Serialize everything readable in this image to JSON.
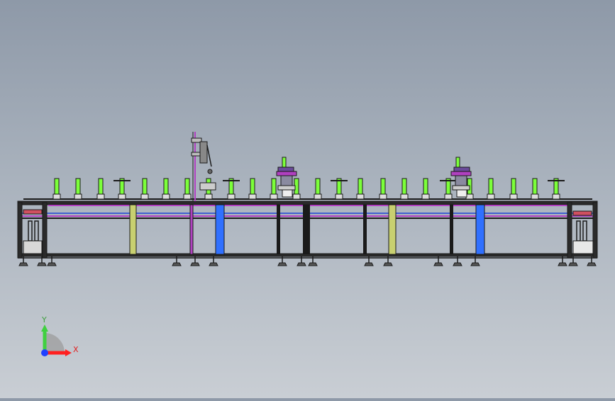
{
  "triad": {
    "y_label": "Y",
    "x_label": "X"
  },
  "colors": {
    "background_top": "#8e99a8",
    "background_bottom": "#c9ced4",
    "frame": "#1a1a1a",
    "rail_magenta": "#b040c0",
    "rail_blue": "#4060d0",
    "roller_green": "#7cff3a",
    "post_blue": "#3070ff",
    "post_olive": "#c8d070",
    "axis_x": "#ff2020",
    "axis_y": "#40d040",
    "axis_z": "#2040ff"
  }
}
